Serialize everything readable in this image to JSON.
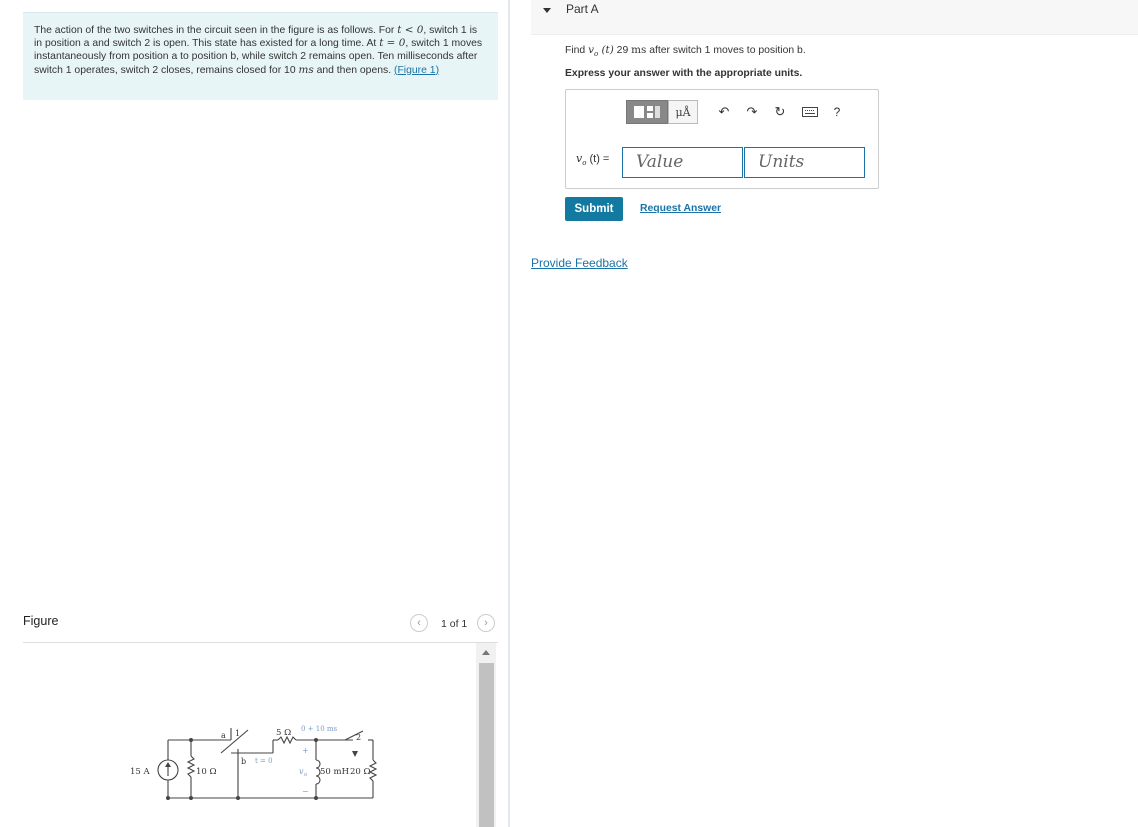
{
  "problem": {
    "intro_part1": "The action of the two switches in the circuit seen in the figure is as follows. For ",
    "cond1": "t < 0",
    "intro_part2": ", switch 1 is in position a and switch 2 is open. This state has existed for a long time. At ",
    "cond2": "t = 0",
    "intro_part3": ", switch 1 moves instantaneously from position a to position b, while switch 2 remains open. Ten milliseconds after switch 1 operates, switch 2 closes, remains closed for 10 ",
    "unit_ms": "ms",
    "intro_part4": " and then opens. ",
    "figure_link": "(Figure 1)"
  },
  "figure_panel": {
    "title": "Figure",
    "pager": "1 of 1",
    "prev_icon": "chevron-left-icon",
    "next_icon": "chevron-right-icon"
  },
  "circuit": {
    "source_label": "15 A",
    "r1_label": "10 Ω",
    "r2_label": "5 Ω",
    "l_label": "50 mH",
    "r3_label": "20 Ω",
    "switch1_a": "a",
    "switch1_b": "b",
    "switch1_num": "1",
    "switch1_time": "t = 0",
    "switch2_num": "2",
    "switch2_time": "0 + 10 ms",
    "vo_label": "v",
    "vo_sub": "o",
    "plus": "+",
    "minus": "−"
  },
  "part": {
    "title": "Part A",
    "question_pre": "Find ",
    "question_var": "v",
    "question_sub": "o",
    "question_arg": " (t)",
    "question_mid": "  29 ",
    "question_unit": "ms",
    "question_post": " after switch 1 moves to position b.",
    "instruction": "Express your answer with the appropriate units."
  },
  "toolbar": {
    "units_label": "μÅ",
    "help_label": "?"
  },
  "answer": {
    "label_var": "v",
    "label_sub": "o",
    "label_rest": " (t) =",
    "value_placeholder": "Value",
    "units_placeholder": "Units"
  },
  "actions": {
    "submit": "Submit",
    "request_answer": "Request Answer",
    "feedback": "Provide Feedback"
  },
  "colors": {
    "accent": "#127aa0",
    "link": "#1a73a8",
    "intro_bg": "#e8f5f7"
  }
}
